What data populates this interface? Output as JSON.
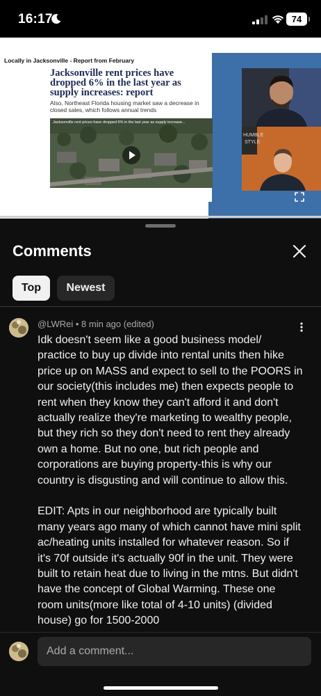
{
  "status_bar": {
    "time": "16:17",
    "battery": "74",
    "icons": [
      "moon-icon",
      "signal-icon",
      "wifi-icon",
      "battery-icon"
    ]
  },
  "video": {
    "slide_header": "Locally in Jacksonville - Report from February",
    "headline": "Jacksonville rent prices have dropped 6% in the last year as supply increases: report",
    "subhead": "Also, Northeast Florida housing market saw a decrease in closed sales, which follows annual trends",
    "thumb_caption": "Jacksonville rent prices have dropped 6% in the last year as supply increase...",
    "cam_sign": "HUMBLE STYLE"
  },
  "comments_panel": {
    "title": "Comments",
    "filters": [
      "Top",
      "Newest"
    ],
    "selected_filter": "Top",
    "comment": {
      "author": "@LWRei",
      "meta": "8 min ago (edited)",
      "paragraphs": [
        "Idk doesn't seem like a good business  model/ practice to buy up divide into rental units then hike price up on MASS and expect to sell to the POORS in our society(this includes me) then expects people to rent when they know they can't afford it and don't actually realize they're marketing to wealthy people, but they rich so they don't need to rent they already own a home. But no one, but rich people and corporations are buying property-this is why our country is disgusting and will continue to allow this.",
        "EDIT: Apts in our neighborhood are typically built many years ago many of which cannot have mini split ac/heating units installed for whatever reason. So if it's 70f outside it's actually 90f in the unit. They were built to retain heat due to living in the mtns. But didn't have the concept of Global Warming. These one room units(more like total of 4-10 units) (divided house) go for 1500-2000"
      ]
    },
    "add_comment_placeholder": "Add a comment..."
  },
  "colors": {
    "background": "#0f0f0f",
    "chip_selected": "#f1f1f1",
    "chip_unselected": "#272727",
    "meta_text": "#aaaaaa",
    "slide_blue": "#3d70a8",
    "headline_navy": "#1d2a55"
  }
}
